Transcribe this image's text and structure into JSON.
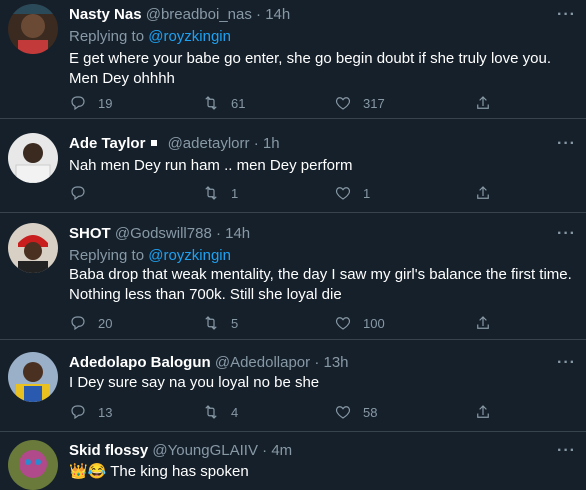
{
  "tweets": [
    {
      "name": "Nasty Nas",
      "handle": "@breadboi_nas",
      "time": "14h",
      "replying_prefix": "Replying to ",
      "replying_to": "@royzkingin",
      "text": "E get where your babe go enter, she go begin doubt if she truly love you. Men Dey ohhhh",
      "replies": "19",
      "retweets": "61",
      "likes": "317"
    },
    {
      "name": "Ade Taylor",
      "handle": "@adetaylorr",
      "time": "1h",
      "text": "Nah men Dey run ham .. men Dey perform",
      "replies": "",
      "retweets": "1",
      "likes": "1"
    },
    {
      "name": "SHOT",
      "handle": "@Godswill788",
      "time": "14h",
      "replying_prefix": "Replying to ",
      "replying_to": "@royzkingin",
      "text": "Baba drop that weak mentality, the day I saw my  girl's balance the first time. Nothing less than 700k.   Still she loyal die",
      "replies": "20",
      "retweets": "5",
      "likes": "100"
    },
    {
      "name": "Adedolapo Balogun",
      "handle": "@Adedollapor",
      "time": "13h",
      "text": "I Dey sure say na you loyal no be she",
      "replies": "13",
      "retweets": "4",
      "likes": "58"
    },
    {
      "name": "Skid flossy",
      "handle": "@YoungGLAIIV",
      "time": "4m",
      "text": "👑😂 The king has spoken"
    }
  ],
  "ui": {
    "dot": "·",
    "more": "···"
  },
  "icons": [
    "reply-icon",
    "retweet-icon",
    "like-icon",
    "share-icon",
    "more-icon"
  ],
  "colors": {
    "background": "#15202b",
    "muted": "#8899a6",
    "link": "#1da1f2",
    "divider": "#38444d"
  }
}
